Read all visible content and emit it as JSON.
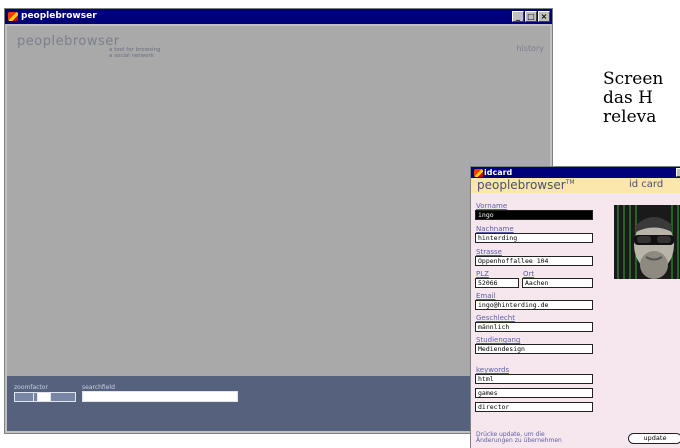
{
  "main_window": {
    "title": "peoplebrowser",
    "brand": "peoplebrowser",
    "tagline_1": "a tool for browsing",
    "tagline_2": "a social network",
    "history": "history",
    "zoom_label": "zoomfactor",
    "search_label": "searchfield",
    "search_value": ""
  },
  "caption": {
    "line1": "Screen",
    "line2": "das H",
    "line3": "releva"
  },
  "idcard_window": {
    "title": "idcard",
    "brand": "peoplebrowser",
    "brand_mark": "TM",
    "header_title": "id card",
    "fields": {
      "vorname": {
        "label": "Vorname",
        "value": "ingo"
      },
      "nachname": {
        "label": "Nachname",
        "value": "hinterding"
      },
      "strasse": {
        "label": "Strasse",
        "value": "Oppenhoffallee 104"
      },
      "plz": {
        "label": "PLZ",
        "value": "52066"
      },
      "ort": {
        "label": "Ort",
        "value": "Aachen"
      },
      "email": {
        "label": "Email",
        "value": "ingo@hinterding.de"
      },
      "geschlecht": {
        "label": "Geschlecht",
        "value": "männlich"
      },
      "studiengang": {
        "label": "Studiengang",
        "value": "Mediendesign"
      }
    },
    "keywords_label": "keywords",
    "keywords": [
      "html",
      "games",
      "director"
    ],
    "hint_1": "Drücke update, um die",
    "hint_2": "Änderungen zu übernehmen",
    "update_label": "update"
  },
  "colors": {
    "titlebar": "#00007b",
    "main_bg": "#a9a9a9",
    "bottom_bar": "#56617e",
    "card_bg": "#f6e7ef",
    "card_header": "#fbe6ab",
    "label_blue": "#5a5fa2"
  },
  "icons": [
    "app-icon",
    "minimize-icon",
    "maximize-icon",
    "close-icon"
  ]
}
